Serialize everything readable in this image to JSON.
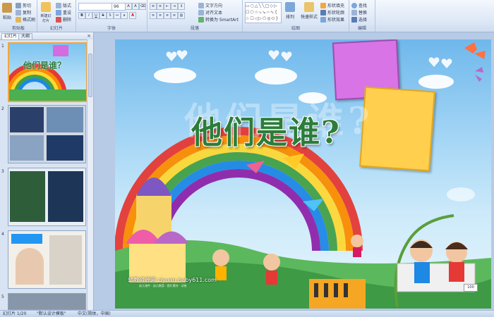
{
  "ribbon": {
    "clipboard": {
      "paste": "粘贴",
      "cut": "剪切",
      "copy": "复制",
      "format_painter": "格式刷",
      "label": "剪贴板"
    },
    "slides": {
      "new_slide": "新建幻灯片",
      "layout": "版式",
      "reset": "重设",
      "delete": "删除",
      "label": "幻灯片"
    },
    "font": {
      "font_size": "96",
      "label": "字体"
    },
    "paragraph": {
      "text_direction": "文字方向",
      "align_text": "对齐文本",
      "smartart": "转换为 SmartArt",
      "label": "段落"
    },
    "drawing": {
      "arrange": "排列",
      "quick_styles": "快速样式",
      "shape_fill": "形状填充",
      "shape_outline": "形状轮廓",
      "shape_effects": "形状效果",
      "label": "绘图"
    },
    "editing": {
      "find": "查找",
      "replace": "替换",
      "select": "选择",
      "label": "编辑"
    }
  },
  "panel": {
    "tab_slides": "幻灯片",
    "tab_outline": "大纲",
    "close": "×",
    "thumbs": [
      {
        "num": "1"
      },
      {
        "num": "2"
      },
      {
        "num": "3"
      },
      {
        "num": "4"
      },
      {
        "num": "5"
      }
    ],
    "thumb1_title": "他们是谁？"
  },
  "slide": {
    "title": "他们是谁?",
    "ghost_title": "他们是谁?",
    "watermark": "幼教资源网 ziyuan.baby611.com",
    "watermark_sub": "幼儿课件 · 幼儿教案 · 图片素材 · 试卷",
    "sign": "100"
  },
  "status": {
    "slide_info": "幻灯片 1/20",
    "theme": "\"默认设计模板\"",
    "language": "中文(简体，中国)"
  },
  "colors": {
    "accent": "#2b7d3a",
    "ribbon": "#dce7f6",
    "selection": "#f3a73b"
  }
}
